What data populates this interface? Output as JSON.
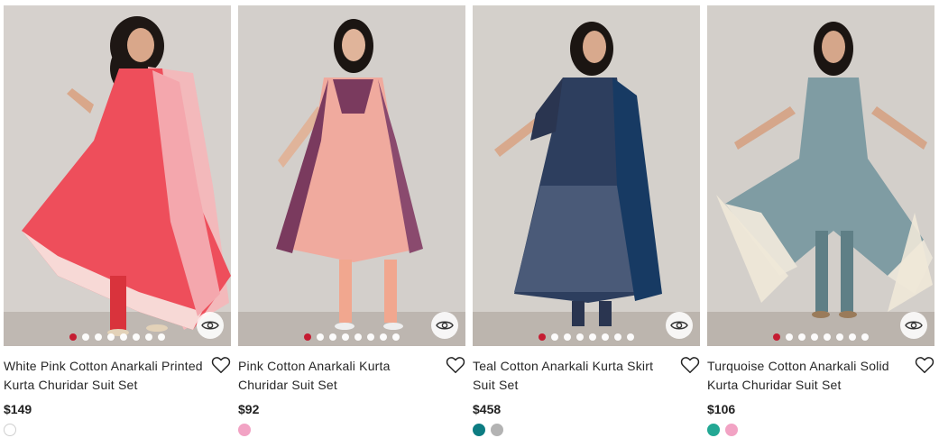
{
  "products": [
    {
      "title": "White Pink Cotton Anarkali Printed Kurta Churidar Suit Set",
      "price": "$149",
      "carousel_count": 8,
      "carousel_active": 1,
      "swatches": [
        "#ffffff"
      ],
      "colors": {
        "dress": "#ef4d5a",
        "dupatta": "#f6c2c2",
        "pants": "#d9333c",
        "accent": "#f7e5e0"
      }
    },
    {
      "title": "Pink Cotton Anarkali Kurta Churidar Suit Set",
      "price": "$92",
      "carousel_count": 8,
      "carousel_active": 1,
      "swatches": [
        "#f2a3c4"
      ],
      "colors": {
        "dress": "#f0aa9e",
        "dupatta": "#7a3a5e",
        "pants": "#f1a78f",
        "accent": "#b69bd4"
      }
    },
    {
      "title": "Teal Cotton Anarkali Kurta Skirt Suit Set",
      "price": "$458",
      "carousel_count": 8,
      "carousel_active": 1,
      "swatches": [
        "#0d7c82",
        "#b3b3b3"
      ],
      "colors": {
        "dress": "#2d3e5e",
        "dupatta": "#173a63",
        "pants": "#2a3550",
        "accent": "#c9cfd8"
      }
    },
    {
      "title": "Turquoise Cotton Anarkali Solid Kurta Churidar Suit Set",
      "price": "$106",
      "carousel_count": 8,
      "carousel_active": 1,
      "swatches": [
        "#23a894",
        "#f2a3c4"
      ],
      "colors": {
        "dress": "#7f9ca3",
        "dupatta": "#e9e4d8",
        "pants": "#5f7f86",
        "accent": "#efe8d8"
      }
    }
  ]
}
